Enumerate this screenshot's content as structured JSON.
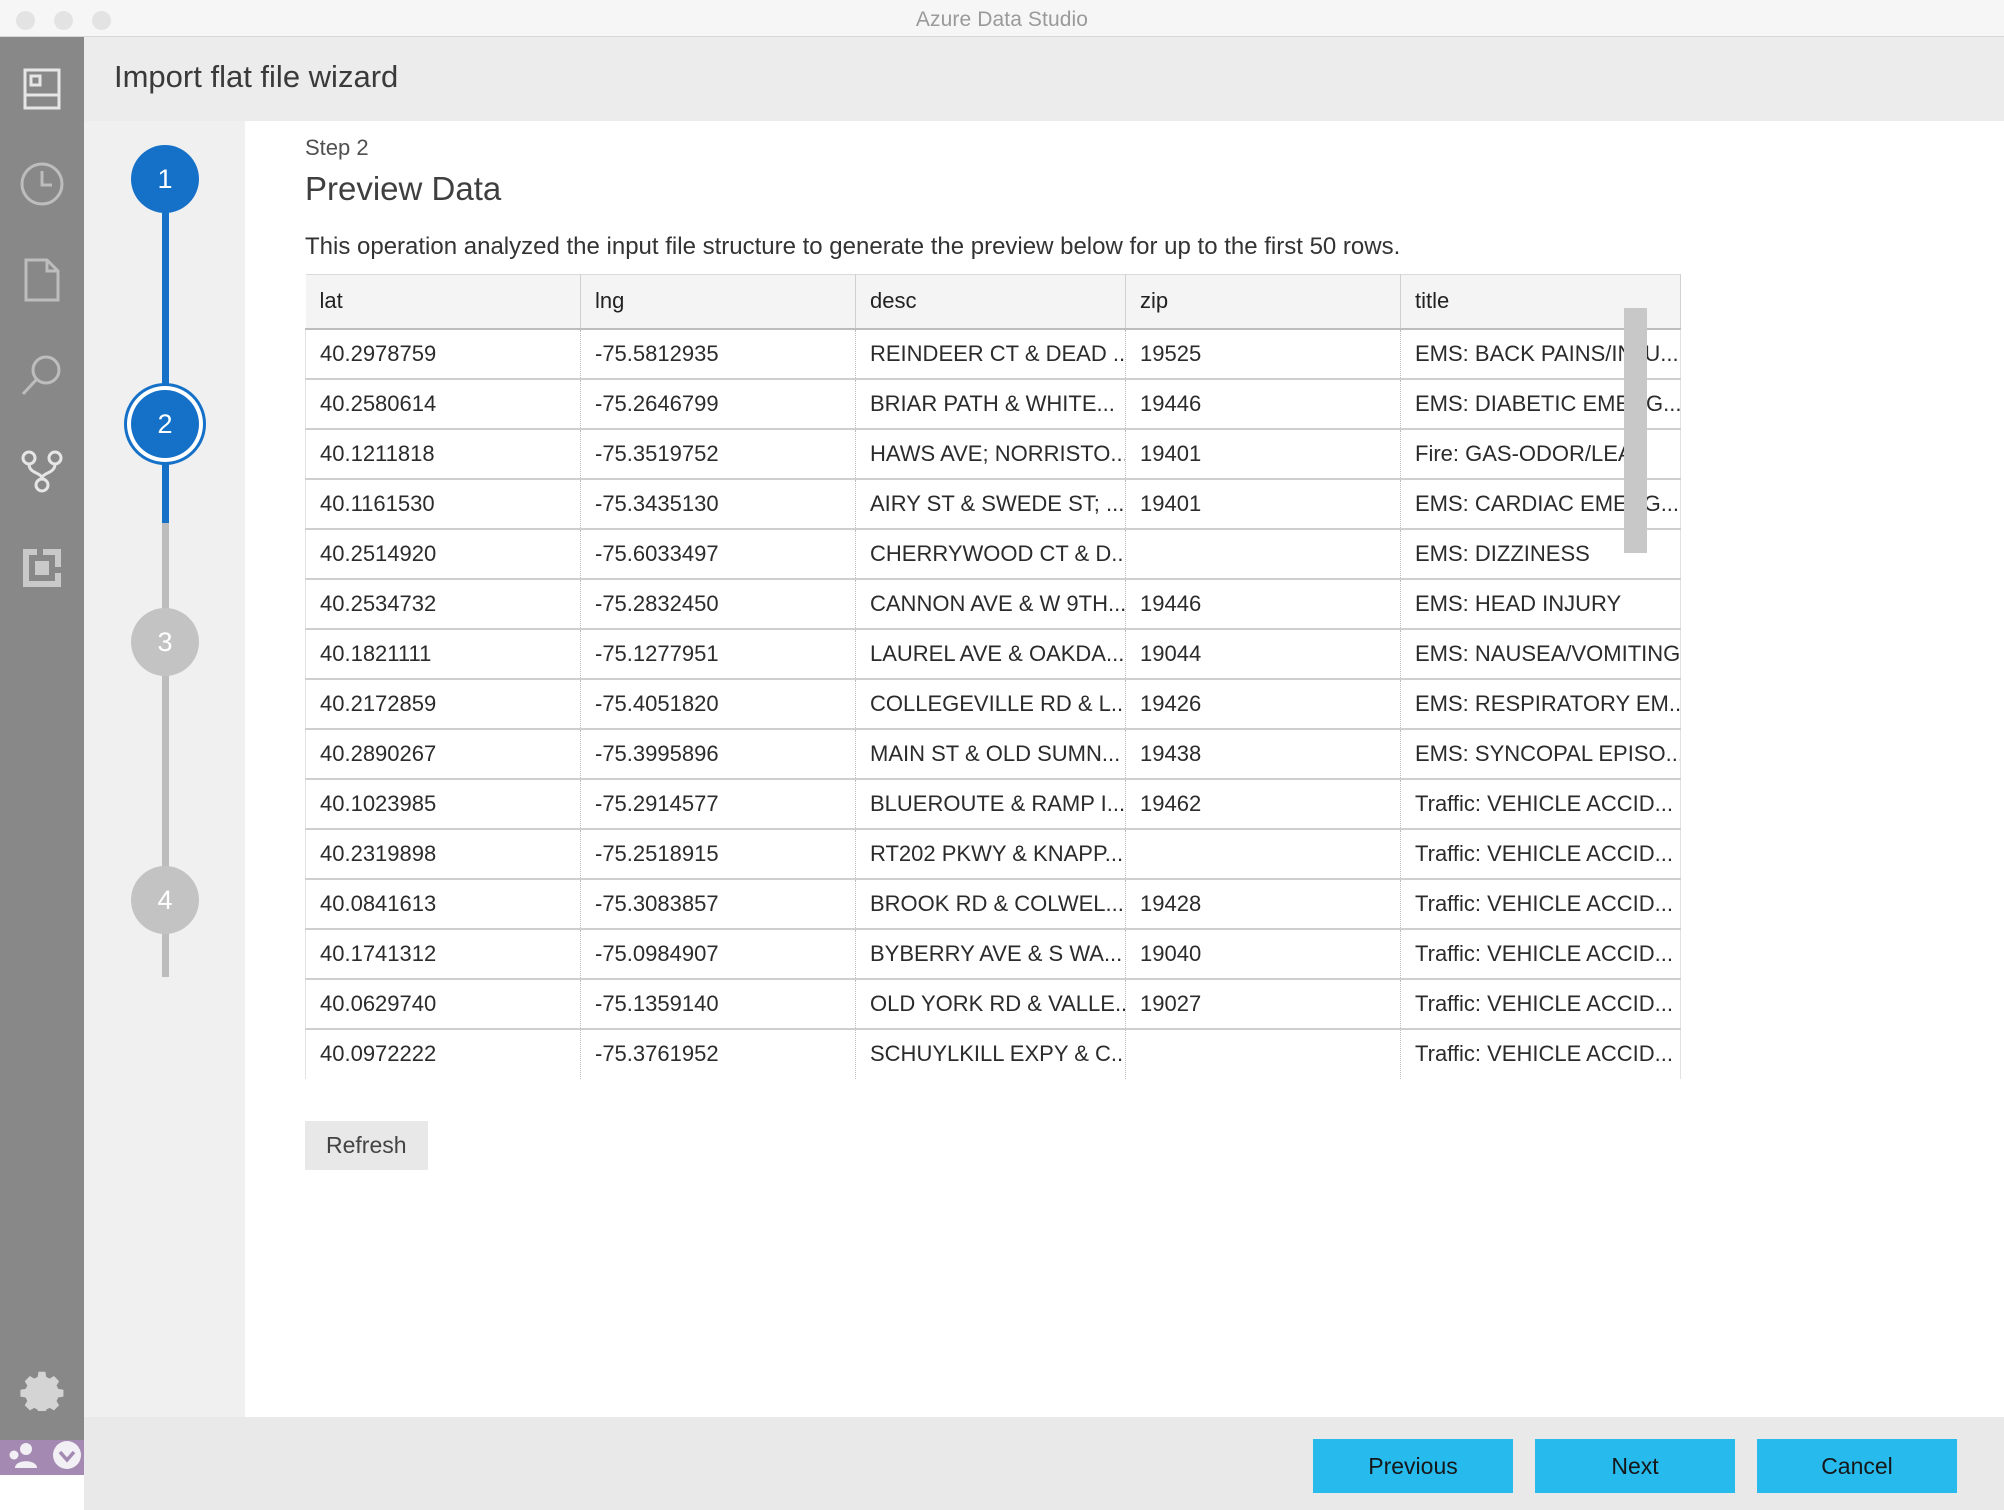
{
  "window": {
    "title": "Azure Data Studio",
    "controls": [
      "close",
      "minimize",
      "maximize"
    ]
  },
  "activity_bar": {
    "items": [
      {
        "name": "servers",
        "icon": "servers-icon"
      },
      {
        "name": "history",
        "icon": "history-clock-icon"
      },
      {
        "name": "notebooks",
        "icon": "file-page-icon"
      },
      {
        "name": "search",
        "icon": "search-magnifier-icon"
      },
      {
        "name": "source-control",
        "icon": "git-branch-icon"
      },
      {
        "name": "extensions",
        "icon": "extensions-icon"
      }
    ],
    "bottom_items": [
      {
        "name": "settings",
        "icon": "gear-icon"
      }
    ],
    "status": [
      {
        "name": "accounts",
        "icon": "accounts-person-icon"
      },
      {
        "name": "notifications",
        "icon": "chevron-down-circle-icon"
      }
    ]
  },
  "wizard": {
    "header_title": "Import flat file wizard",
    "step_label": "Step 2",
    "page_heading": "Preview Data",
    "description": "This operation analyzed the input file structure to generate the preview below for up to the first 50 rows.",
    "steps": [
      {
        "number": "1",
        "state": "done"
      },
      {
        "number": "2",
        "state": "current"
      },
      {
        "number": "3",
        "state": "pending"
      },
      {
        "number": "4",
        "state": "pending"
      }
    ],
    "refresh_label": "Refresh",
    "buttons": {
      "previous": "Previous",
      "next": "Next",
      "cancel": "Cancel"
    }
  },
  "preview_table": {
    "columns": [
      "lat",
      "lng",
      "desc",
      "zip",
      "title"
    ],
    "rows": [
      [
        "40.2978759",
        "-75.5812935",
        "REINDEER CT & DEAD ...",
        "19525",
        "EMS: BACK PAINS/INJU..."
      ],
      [
        "40.2580614",
        "-75.2646799",
        "BRIAR PATH & WHITE...",
        "19446",
        "EMS: DIABETIC EMERG..."
      ],
      [
        "40.1211818",
        "-75.3519752",
        "HAWS AVE; NORRISTO...",
        "19401",
        "Fire: GAS-ODOR/LEAK"
      ],
      [
        "40.1161530",
        "-75.3435130",
        "AIRY ST & SWEDE ST; ...",
        "19401",
        "EMS: CARDIAC EMERG..."
      ],
      [
        "40.2514920",
        "-75.6033497",
        "CHERRYWOOD CT & D...",
        "",
        "EMS: DIZZINESS"
      ],
      [
        "40.2534732",
        "-75.2832450",
        "CANNON AVE & W 9TH...",
        "19446",
        "EMS: HEAD INJURY"
      ],
      [
        "40.1821111",
        "-75.1277951",
        "LAUREL AVE & OAKDA...",
        "19044",
        "EMS: NAUSEA/VOMITING"
      ],
      [
        "40.2172859",
        "-75.4051820",
        "COLLEGEVILLE RD & L...",
        "19426",
        "EMS: RESPIRATORY EM..."
      ],
      [
        "40.2890267",
        "-75.3995896",
        "MAIN ST & OLD SUMN...",
        "19438",
        "EMS: SYNCOPAL EPISO..."
      ],
      [
        "40.1023985",
        "-75.2914577",
        "BLUEROUTE & RAMP I...",
        "19462",
        "Traffic: VEHICLE ACCID..."
      ],
      [
        "40.2319898",
        "-75.2518915",
        "RT202 PKWY & KNAPP...",
        "",
        "Traffic: VEHICLE ACCID..."
      ],
      [
        "40.0841613",
        "-75.3083857",
        "BROOK RD & COLWEL...",
        "19428",
        "Traffic: VEHICLE ACCID..."
      ],
      [
        "40.1741312",
        "-75.0984907",
        "BYBERRY AVE & S WA...",
        "19040",
        "Traffic: VEHICLE ACCID..."
      ],
      [
        "40.0629740",
        "-75.1359140",
        "OLD YORK RD & VALLE...",
        "19027",
        "Traffic: VEHICLE ACCID..."
      ],
      [
        "40.0972222",
        "-75.3761952",
        "SCHUYLKILL EXPY & C...",
        "",
        "Traffic: VEHICLE ACCID..."
      ]
    ]
  },
  "colors": {
    "accent_blue": "#1571c8",
    "button_cyan": "#26bbec",
    "activity_bar": "#888888",
    "status_purple": "#a489b2",
    "header_gray": "#ececec",
    "rail_gray": "#c3c3c3"
  }
}
